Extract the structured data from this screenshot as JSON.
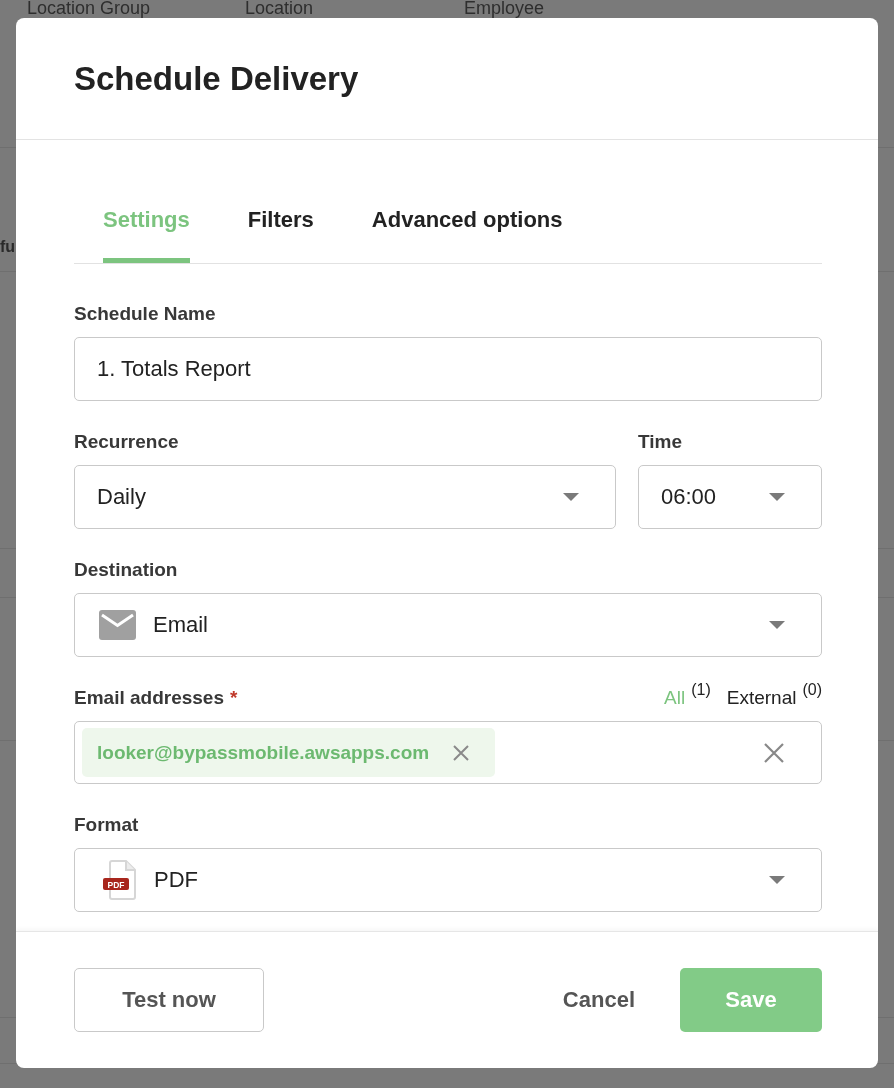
{
  "background_page": {
    "column_headers": [
      "Location Group",
      "Location",
      "Employee"
    ],
    "cut_heading": "fu"
  },
  "dialog": {
    "title": "Schedule Delivery",
    "tabs": [
      {
        "label": "Settings",
        "selected": true
      },
      {
        "label": "Filters",
        "selected": false
      },
      {
        "label": "Advanced options",
        "selected": false
      }
    ],
    "rows": [
      {
        "fields": [
          {
            "kind": "text",
            "label": "Schedule Name",
            "value": "1. Totals Report"
          }
        ]
      },
      {
        "fields": [
          {
            "kind": "select",
            "label": "Recurrence",
            "value": "Daily"
          },
          {
            "kind": "select",
            "label": "Time",
            "value": "06:00"
          }
        ]
      },
      {
        "fields": [
          {
            "kind": "destination",
            "label": "Destination",
            "value": "Email"
          }
        ]
      },
      {
        "fields": [
          {
            "kind": "recipients",
            "label": "Email addresses",
            "required_mark": "*",
            "filters": [
              {
                "label": "All",
                "count": "(1)",
                "selected": true
              },
              {
                "label": "External",
                "count": "(0)",
                "selected": false
              }
            ],
            "chips": [
              "looker@bypassmobile.awsapps.com"
            ]
          }
        ]
      },
      {
        "fields": [
          {
            "kind": "format",
            "label": "Format",
            "value": "PDF",
            "icon_label": "PDF"
          }
        ]
      }
    ],
    "footer": {
      "left_buttons": [
        {
          "kind": "outline",
          "label": "Test now"
        }
      ],
      "right_buttons": [
        {
          "kind": "text",
          "label": "Cancel"
        },
        {
          "kind": "primary",
          "label": "Save"
        }
      ]
    }
  }
}
